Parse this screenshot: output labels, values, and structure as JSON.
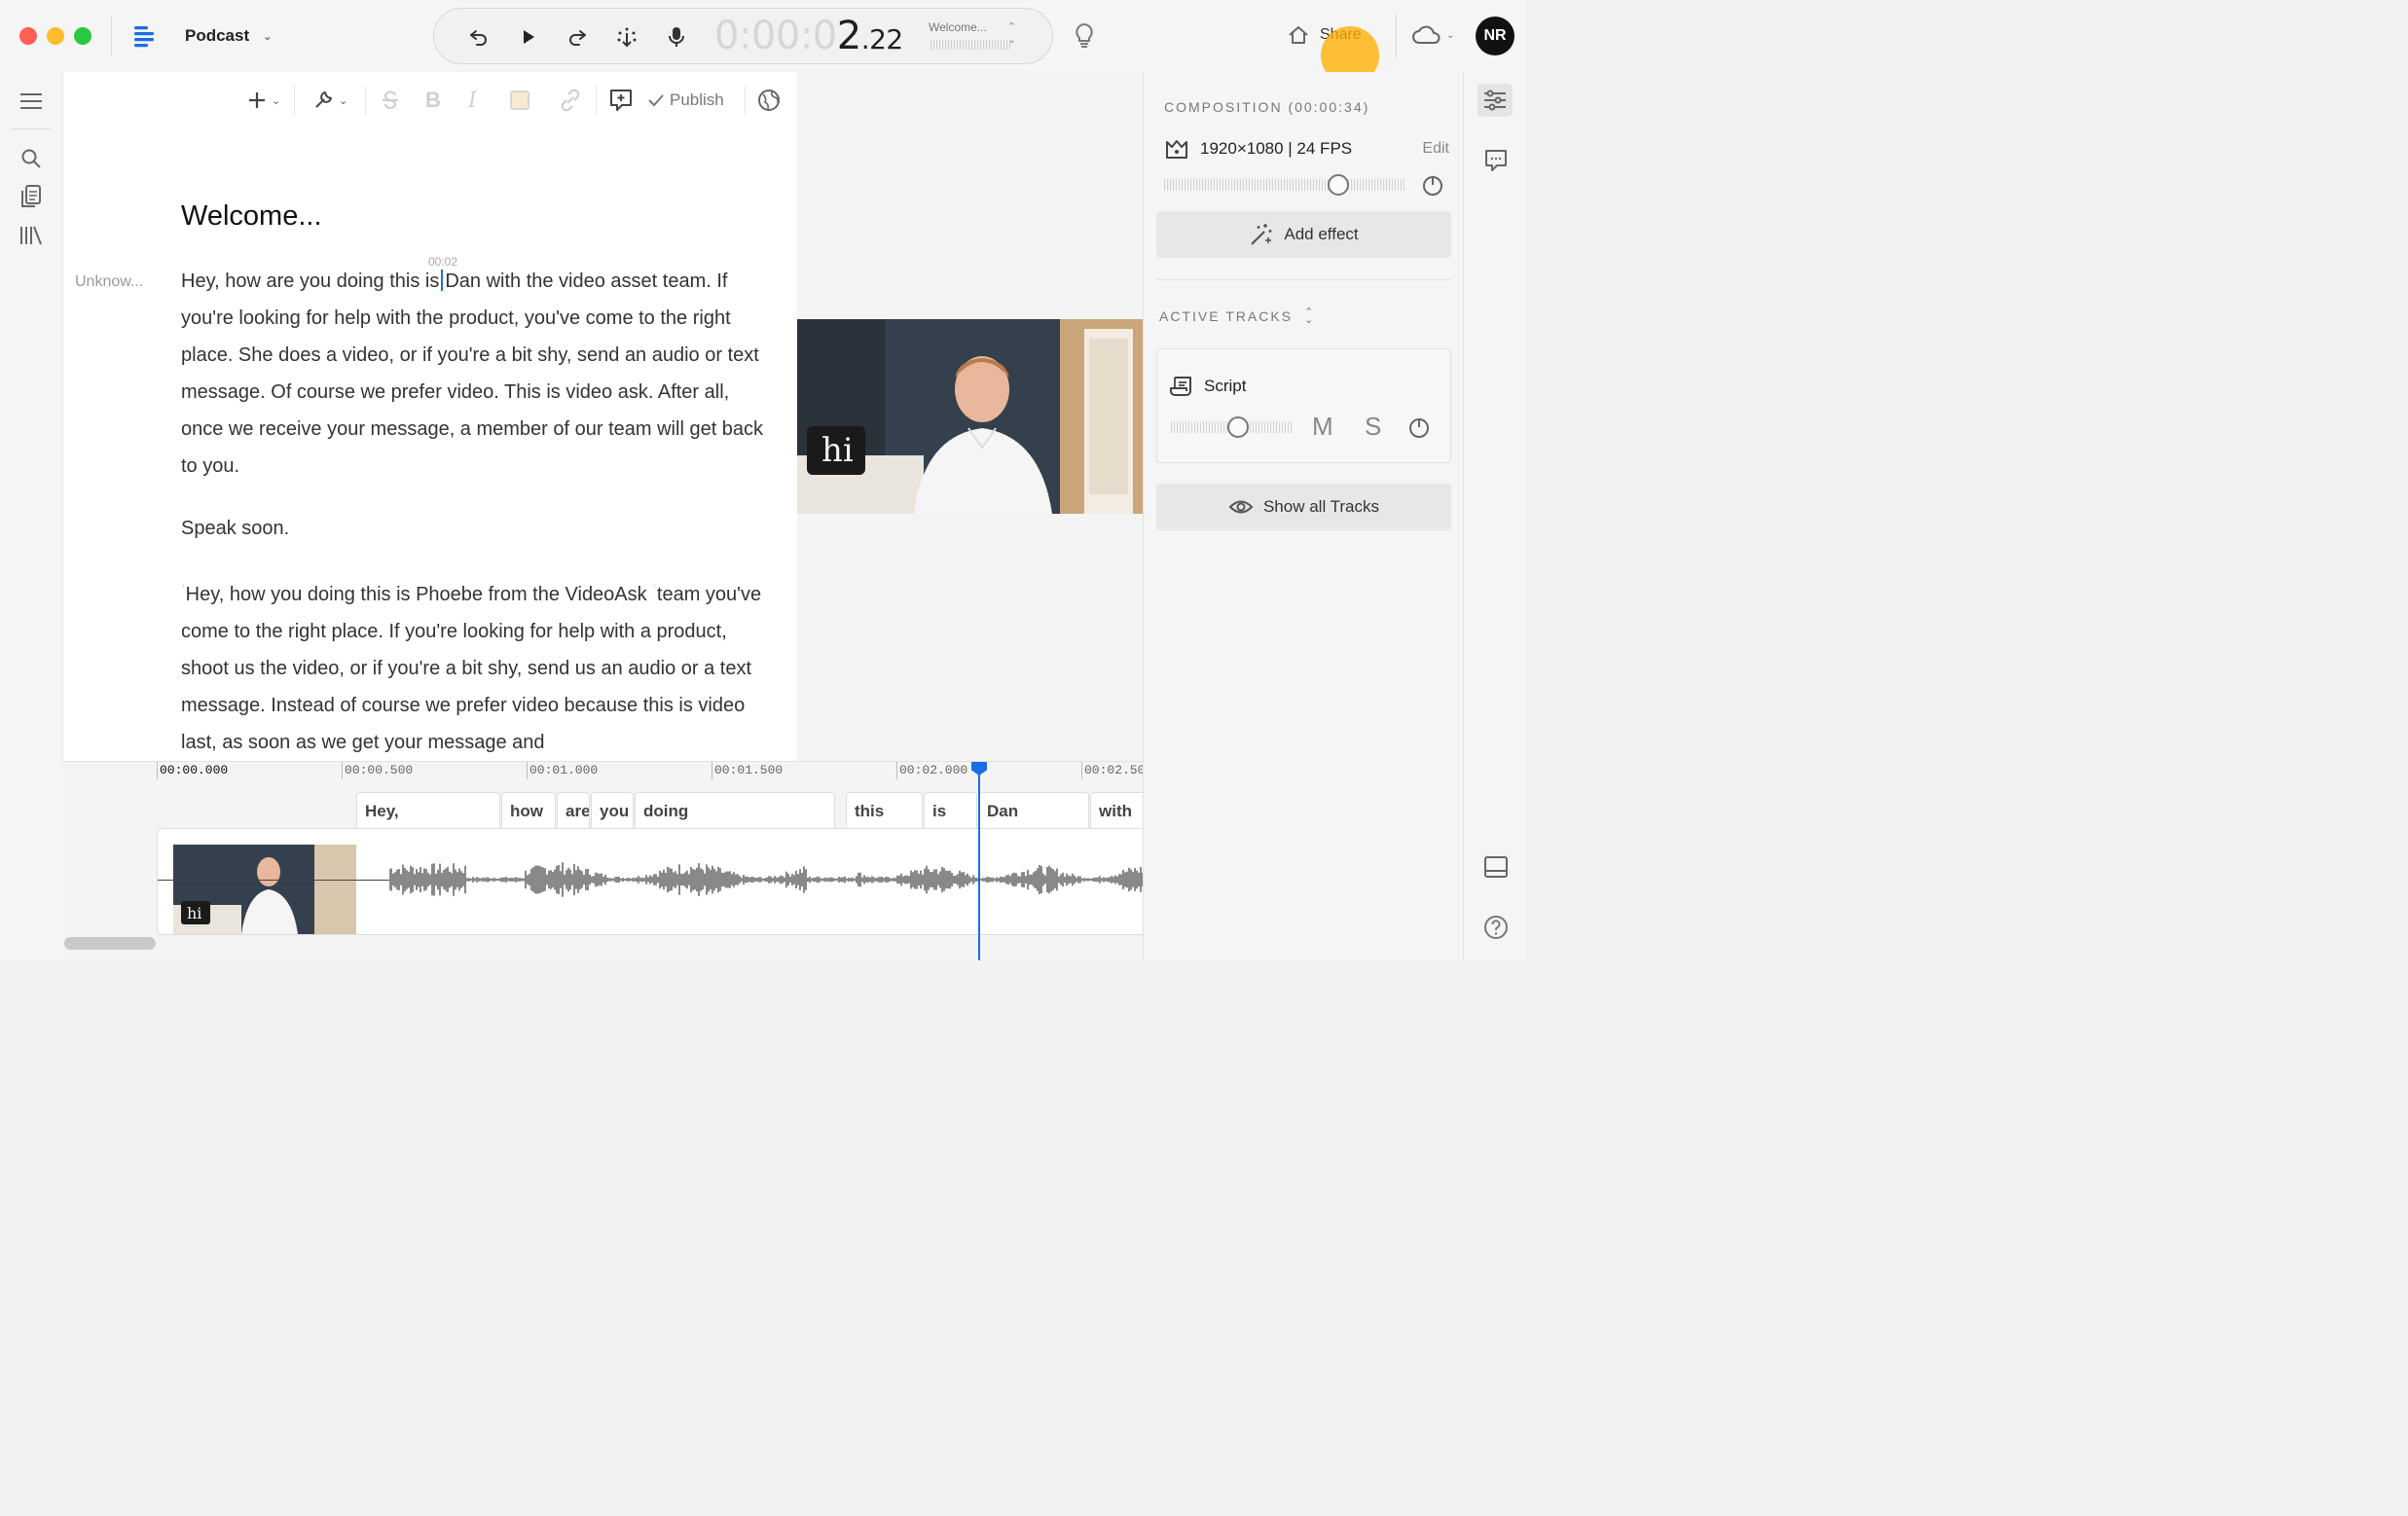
{
  "app": {
    "project_name": "Podcast",
    "timecode": {
      "dim": "0:00:0",
      "main": "2",
      "fraction": ".22"
    },
    "composition_selector": "Welcome...",
    "share_label": "Share",
    "user_initials": "NR"
  },
  "toolbar": {
    "publish_label": "Publish"
  },
  "document": {
    "title": "Welcome...",
    "speaker": "Unknow...",
    "timestamp_marker": "00:02",
    "paragraph1_before_caret": "Hey, how are you doing this is",
    "paragraph1_after_caret": "Dan with the video asset team. If you're looking for help with the product, you've come to the right place. She does a video, or if you're a bit shy, send an audio or text message. Of course we prefer video. This is video ask. After all, once we receive your message, a member of our team will get back to you.",
    "paragraph2": "Speak soon.",
    "paragraph3_start": "Hey, how you doing this is Phoebe from the VideoAsk",
    "paragraph3_rest_first": "team",
    "paragraph3_rest": "you've come to the right place. If you're looking for help with a product, shoot us the video, or if you're a bit shy, send us an audio or a text message. Instead of course we prefer video because this is video last, as soon as we get your message and"
  },
  "composition": {
    "header": "COMPOSITION (00:00:34)",
    "resolution": "1920×1080 | 24 FPS",
    "edit_label": "Edit",
    "volume_level": 0.72,
    "add_effect_label": "Add effect"
  },
  "active_tracks": {
    "header": "ACTIVE TRACKS",
    "tracks": [
      {
        "name": "Script",
        "volume_level": 0.55,
        "mute_label": "M",
        "solo_label": "S"
      }
    ],
    "show_all_label": "Show all Tracks"
  },
  "timeline": {
    "ticks": [
      "00:00.000",
      "00:00.500",
      "00:01.000",
      "00:01.500",
      "00:02.000",
      "00:02.500"
    ],
    "words": [
      "Hey,",
      "how",
      "are",
      "you",
      "doing",
      "this",
      "is",
      "Dan",
      "with"
    ]
  },
  "colors": {
    "accent": "#1a6de5",
    "cursor_highlight": "#ffb000",
    "traffic_red": "#fe5f57",
    "traffic_yellow": "#febc2e",
    "traffic_green": "#28c840"
  }
}
